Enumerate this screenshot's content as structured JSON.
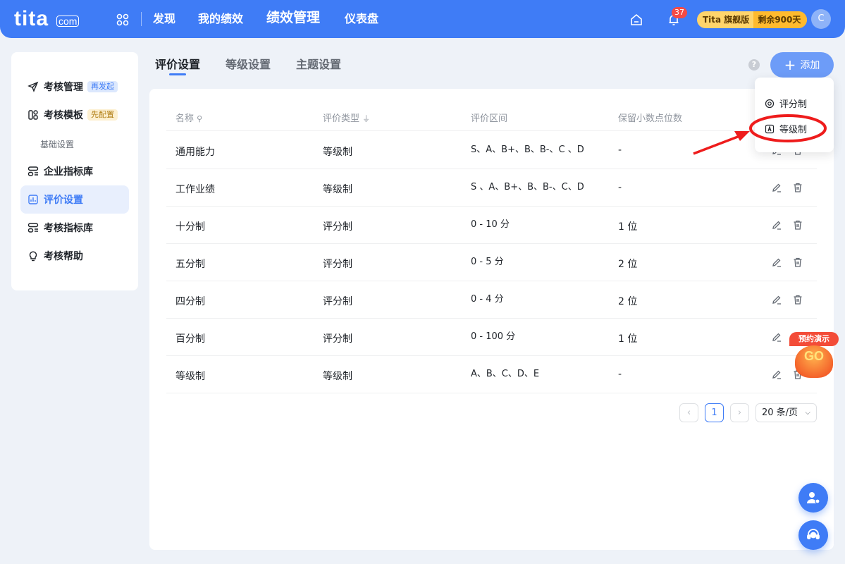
{
  "brand": {
    "logo": "tita",
    "logo_suffix": "com",
    "accent": "#3f7cf6"
  },
  "topnav": {
    "items": [
      "发现",
      "我的绩效",
      "绩效管理",
      "仪表盘"
    ],
    "active_index": 2,
    "notification_count": "37",
    "plan_label": "Tita 旗舰版",
    "plan_remaining": "剩余900天",
    "avatar_initial": "C"
  },
  "sidebar": {
    "items": [
      {
        "label": "考核管理",
        "tag": "再发起"
      },
      {
        "label": "考核模板",
        "tag": "先配置"
      },
      {
        "label": "企业指标库"
      },
      {
        "label": "评价设置"
      },
      {
        "label": "考核指标库"
      },
      {
        "label": "考核帮助"
      }
    ],
    "group_label": "基础设置",
    "active": "评价设置"
  },
  "tabs": [
    "评价设置",
    "等级设置",
    "主题设置"
  ],
  "active_tab": "评价设置",
  "toolbar": {
    "help": "?",
    "add_label": "添加"
  },
  "add_menu": {
    "items": [
      "评分制",
      "等级制"
    ],
    "highlighted": "等级制"
  },
  "table": {
    "columns": [
      "名称",
      "评价类型",
      "评价区间",
      "保留小数点位数"
    ],
    "rows": [
      {
        "name": "通用能力",
        "type": "等级制",
        "range": "S、A、B+、B、B-、C 、D",
        "decimals": "-"
      },
      {
        "name": "工作业绩",
        "type": "等级制",
        "range": "S 、A、B+、B、B-、C、D",
        "decimals": "-"
      },
      {
        "name": "十分制",
        "type": "评分制",
        "range": "0 - 10 分",
        "decimals": "1 位"
      },
      {
        "name": "五分制",
        "type": "评分制",
        "range": "0 - 5 分",
        "decimals": "2 位"
      },
      {
        "name": "四分制",
        "type": "评分制",
        "range": "0 - 4 分",
        "decimals": "2 位"
      },
      {
        "name": "百分制",
        "type": "评分制",
        "range": "0 - 100 分",
        "decimals": "1 位"
      },
      {
        "name": "等级制",
        "type": "等级制",
        "range": "A、B、C、D、E",
        "decimals": "-"
      }
    ]
  },
  "pagination": {
    "prev": "‹",
    "current_page": "1",
    "next": "›",
    "page_size": "20 条/页"
  },
  "promo": {
    "label": "预约演示",
    "badge": "GO"
  }
}
